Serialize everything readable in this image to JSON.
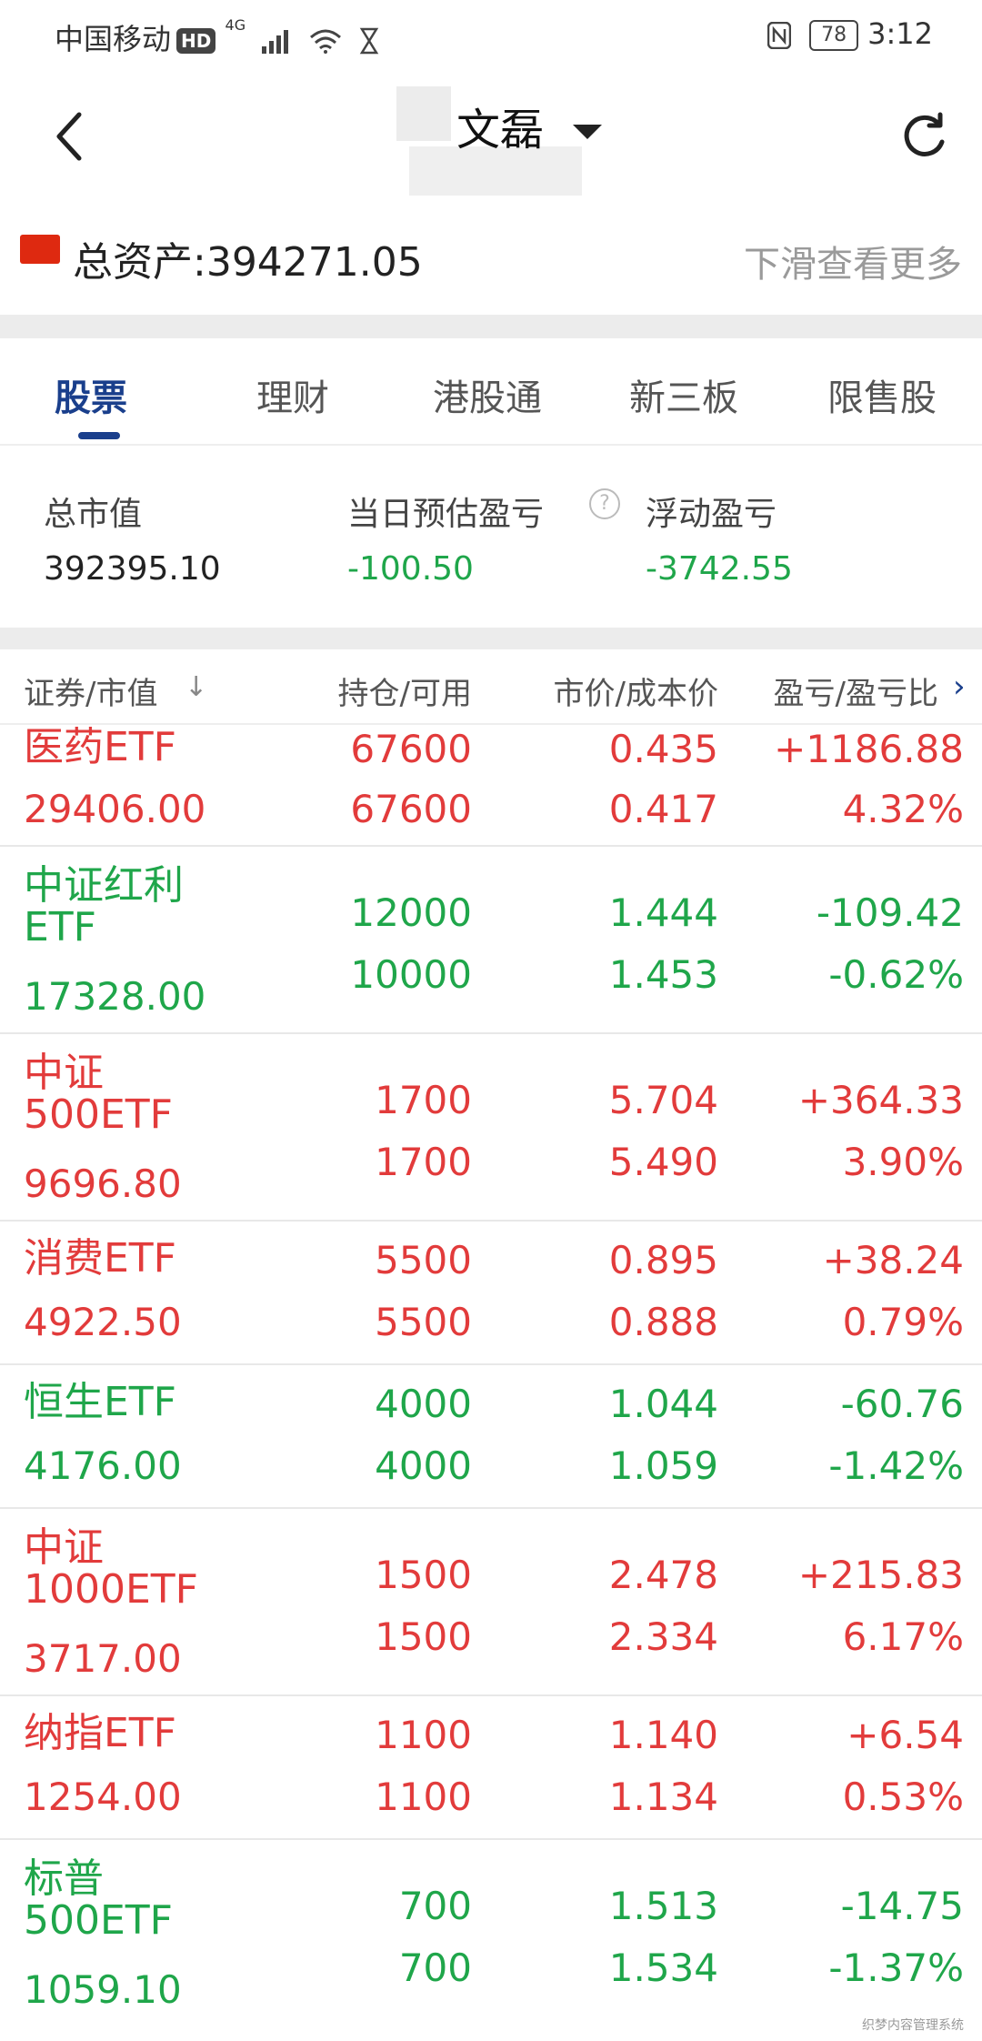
{
  "status_bar": {
    "carrier": "中国移动",
    "network": "4G",
    "battery": "78",
    "time": "3:12"
  },
  "header": {
    "title": "文磊"
  },
  "assets": {
    "label": "总资产:394271.05",
    "more": "下滑查看更多"
  },
  "tabs": [
    {
      "label": "股票",
      "active": true
    },
    {
      "label": "理财"
    },
    {
      "label": "港股通"
    },
    {
      "label": "新三板"
    },
    {
      "label": "限售股"
    }
  ],
  "summary": {
    "market_value_label": "总市值",
    "market_value": "392395.10",
    "daily_pl_label": "当日预估盈亏",
    "daily_pl": "-100.50",
    "floating_pl_label": "浮动盈亏",
    "floating_pl": "-3742.55"
  },
  "columns": [
    "证券/市值",
    "持仓/可用",
    "市价/成本价",
    "盈亏/盈亏比"
  ],
  "holdings": [
    {
      "name": "医药ETF",
      "value": "29406.00",
      "position": "67600",
      "available": "67600",
      "price": "0.435",
      "cost": "0.417",
      "pl": "+1186.88",
      "pl_ratio": "4.32%",
      "trend": "up"
    },
    {
      "name": "中证红利ETF",
      "value": "17328.00",
      "position": "12000",
      "available": "10000",
      "price": "1.444",
      "cost": "1.453",
      "pl": "-109.42",
      "pl_ratio": "-0.62%",
      "trend": "down"
    },
    {
      "name": "中证500ETF",
      "value": "9696.80",
      "position": "1700",
      "available": "1700",
      "price": "5.704",
      "cost": "5.490",
      "pl": "+364.33",
      "pl_ratio": "3.90%",
      "trend": "up"
    },
    {
      "name": "消费ETF",
      "value": "4922.50",
      "position": "5500",
      "available": "5500",
      "price": "0.895",
      "cost": "0.888",
      "pl": "+38.24",
      "pl_ratio": "0.79%",
      "trend": "up"
    },
    {
      "name": "恒生ETF",
      "value": "4176.00",
      "position": "4000",
      "available": "4000",
      "price": "1.044",
      "cost": "1.059",
      "pl": "-60.76",
      "pl_ratio": "-1.42%",
      "trend": "down"
    },
    {
      "name": "中证1000ETF",
      "value": "3717.00",
      "position": "1500",
      "available": "1500",
      "price": "2.478",
      "cost": "2.334",
      "pl": "+215.83",
      "pl_ratio": "6.17%",
      "trend": "up"
    },
    {
      "name": "纳指ETF",
      "value": "1254.00",
      "position": "1100",
      "available": "1100",
      "price": "1.140",
      "cost": "1.134",
      "pl": "+6.54",
      "pl_ratio": "0.53%",
      "trend": "up"
    },
    {
      "name": "标普500ETF",
      "value": "1059.10",
      "position": "700",
      "available": "700",
      "price": "1.513",
      "cost": "1.534",
      "pl": "-14.75",
      "pl_ratio": "-1.37%",
      "trend": "down"
    }
  ],
  "watermark": "织梦内容管理系统"
}
